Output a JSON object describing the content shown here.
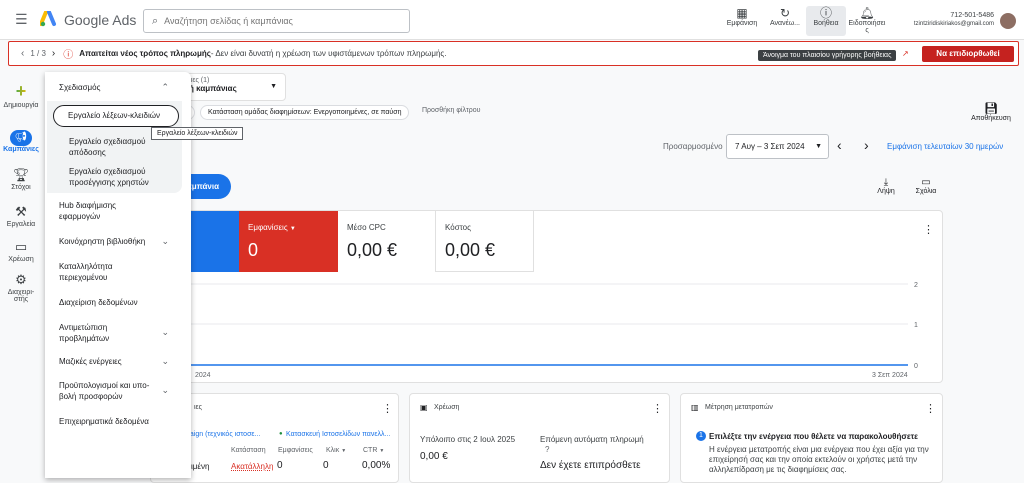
{
  "app": {
    "title": "Google Ads"
  },
  "search": {
    "placeholder": "Αναζήτηση σελίδας ή καμπάνιας"
  },
  "toolbar": {
    "appearance": "Εμφάνιση",
    "refresh": "Ανανέω...",
    "help": "Βοήθεια",
    "notifications": "Ειδοποιήσει ς"
  },
  "account": {
    "id": "712-501-5486",
    "email": "tzintziridiskiriakos@gmail.com"
  },
  "tooltip_help": "Άνοιγμα του πλαισίου γρήγορης βοήθειας",
  "alert": {
    "counter": "1 / 3",
    "title": "Απαιτείται νέος τρόπος πληρωμής",
    "message": " - Δεν είναι δυνατή η χρέωση των υφιστάμενων τρόπων πληρωμής.",
    "fix": "Να επιδιορθωθεί"
  },
  "rail": {
    "create": "Δημιουργία",
    "campaigns": "Καμπάνιες",
    "goals": "Στόχοι",
    "tools": "Εργαλεία",
    "billing": "Χρέωση",
    "admin": "Διαχειρι- στής"
  },
  "tools_panel": {
    "planning": "Σχεδιασμός",
    "keyword_tool": "Εργαλείο λέξεων-κλειδιών",
    "performance_planner": "Εργαλείο σχεδιασμού απόδοσης",
    "reach_planner": "Εργαλείο σχεδιασμού προσέγγισης χρηστών",
    "hub": "Hub διαφήμισης εφαρμογών",
    "shared_library": "Κοινόχρηστη βιβλιοθήκη",
    "content_suitability": "Καταλληλότητα περιεχομένου",
    "data_manager": "Διαχείριση δεδομένων",
    "troubleshooting": "Αντιμετώπιση προβλημάτων",
    "bulk_actions": "Μαζικές ενέργειες",
    "budgets": "Προϋπολογισμοί και υπο- βολή προσφορών",
    "business_data": "Επιχειρηματικά δεδομένα"
  },
  "tooltip_keyword": "Εργαλείο λέξεων-κλειδιών",
  "campaign_picker": {
    "label": "καμπάνιες (1)",
    "value": "πιλογή καμπάνιας"
  },
  "filters": {
    "status": "Κατάσταση ομάδας διαφημίσεων: Ενεργοποιημένες, σε παύση",
    "add": "Προσθήκη φίλτρου"
  },
  "save": "Αποθήκευση",
  "date": {
    "label": "Προσαρμοσμένο",
    "range": "7 Αυγ – 3 Σεπ 2024",
    "last30": "Εμφάνιση τελευταίων 30 ημερών"
  },
  "new_campaign": "καμπάνια",
  "actions": {
    "download": "Λήψη",
    "comments": "Σχόλια"
  },
  "metrics": [
    {
      "label": "Εμφανίσεις",
      "value": "0",
      "active": true
    },
    {
      "label": "Μέσο CPC",
      "value": "0,00 €"
    },
    {
      "label": "Κόστος",
      "value": "0,00 €"
    }
  ],
  "chart": {
    "y_ticks": [
      "2",
      "1",
      "0"
    ],
    "x_start": "2024",
    "x_end": "3 Σεπ 2024"
  },
  "chart_data": {
    "type": "line",
    "x": [
      "7 Αυγ 2024",
      "3 Σεπ 2024"
    ],
    "values": [
      0,
      0
    ],
    "ylim": [
      0,
      2
    ]
  },
  "campaigns_card": {
    "title": "ιες",
    "row_name": "paign (τεχνικός ιστοσε...",
    "row_adgroup": "Κατασκευή Ιστοσελίδων πανελλ...",
    "cols": [
      "Κατάσταση",
      "Εμφανίσεις",
      "Κλικ",
      "CTR"
    ],
    "row": {
      "state": "ιμένη",
      "status": "Ακατάλληλη",
      "impressions": "0",
      "clicks": "0",
      "ctr": "0,00%"
    }
  },
  "billing_card": {
    "title": "Χρέωση",
    "balance_label": "Υπόλοιπο στις 2 Ιουλ 2025",
    "balance": "0,00 €",
    "next_label": "Επόμενη αυτόματη πληρωμή",
    "next_value": "Δεν έχετε επιπρόσθετε"
  },
  "conv_card": {
    "title": "Μέτρηση μετατροπών",
    "step": "1",
    "heading": "Επιλέξτε την ενέργεια που θέλετε να παρακολουθήσετε",
    "body": "Η ενέργεια μετατροπής είναι μια ενέργεια που έχει αξία για την επιχείρησή σας και την οποία εκτελούν οι χρήστες μετά την αλληλεπίδραση με τις διαφημίσεις σας."
  }
}
